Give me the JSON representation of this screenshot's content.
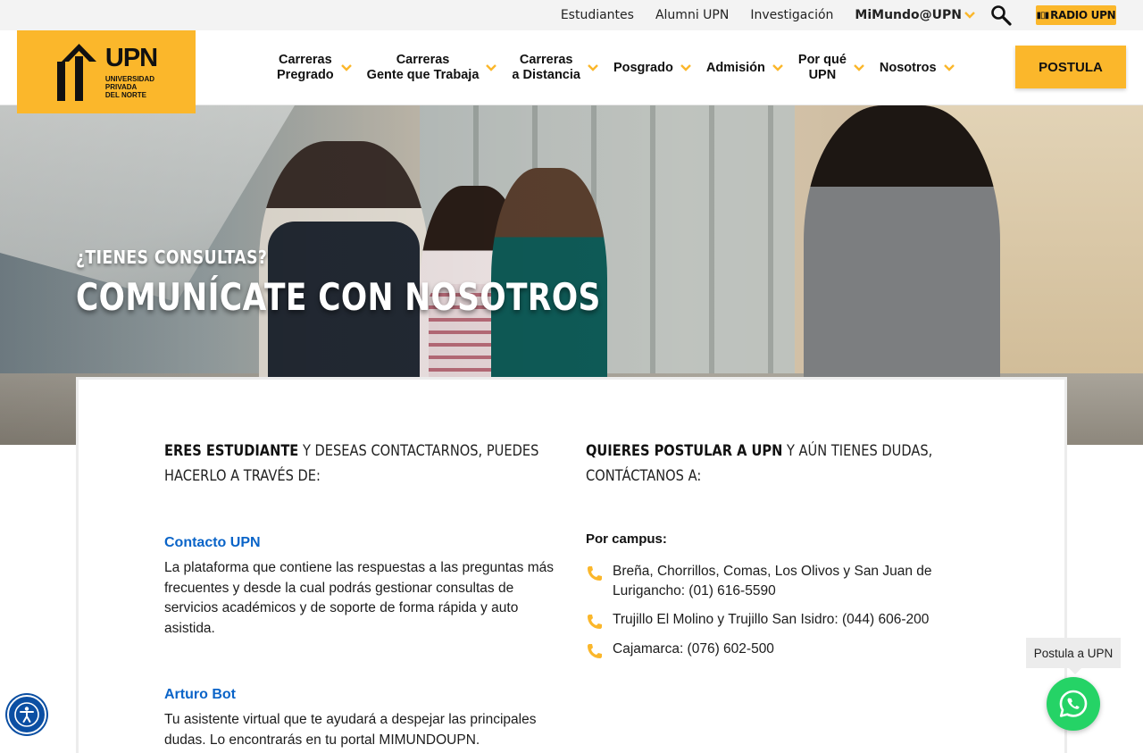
{
  "utility": {
    "links": [
      "Estudiantes",
      "Alumni UPN",
      "Investigación"
    ],
    "mimundo": "MiMundo@UPN",
    "radio_label": "RADIO UPN"
  },
  "logo": {
    "name": "UPN",
    "subtitle": "UNIVERSIDAD\nPRIVADA\nDEL NORTE"
  },
  "nav": {
    "items": [
      {
        "label": "Carreras\nPregrado"
      },
      {
        "label": "Carreras\nGente que Trabaja"
      },
      {
        "label": "Carreras\na Distancia"
      },
      {
        "label": "Posgrado"
      },
      {
        "label": "Admisión"
      },
      {
        "label": "Por qué\nUPN"
      },
      {
        "label": "Nosotros"
      }
    ],
    "cta": "POSTULA"
  },
  "hero": {
    "kicker": "¿TIENES CONSULTAS?",
    "title": "COMUNÍCATE CON NOSOTROS"
  },
  "students": {
    "lead_bold": "ERES ESTUDIANTE",
    "lead_rest": " Y DESEAS CONTACTARNOS, PUEDES HACERLO A TRAVÉS DE:",
    "contacto_title": "Contacto UPN",
    "contacto_text": "La plataforma que contiene las respuestas a las preguntas más frecuentes y desde la cual podrás gestionar consultas de servicios académicos y de soporte de forma rápida y auto asistida.",
    "bot_title": "Arturo Bot",
    "bot_text": "Tu asistente virtual que te ayudará a despejar las principales dudas. Lo encontrarás en tu portal MIMUNDOUPN."
  },
  "applicants": {
    "lead_bold": "QUIERES POSTULAR A UPN",
    "lead_rest": " Y AÚN TIENES DUDAS, CONTÁCTANOS A:",
    "campus_heading": "Por campus:",
    "phones": [
      "Breña, Chorrillos, Comas, Los Olivos y San Juan de Lurigancho: (01) 616-5590",
      "Trujillo El Molino y Trujillo San Isidro: (044) 606-200",
      "Cajamarca: (076) 602-500"
    ]
  },
  "widgets": {
    "tooltip": "Postula a UPN"
  },
  "colors": {
    "brand_yellow": "#fbb72b",
    "link_blue": "#0a64c8",
    "whatsapp_green": "#25d366",
    "accessibility_blue": "#0b4fa3"
  }
}
